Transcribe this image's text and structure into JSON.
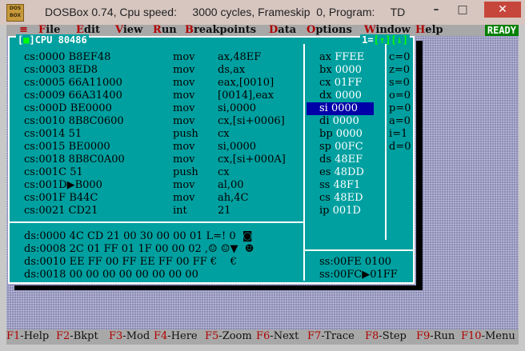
{
  "window": {
    "title": "DOSBox 0.74, Cpu speed:     3000 cycles, Frameskip  0, Program:     TD",
    "icon_text": "DOS BOX",
    "minimize": "–",
    "maximize": "□",
    "close": "✕"
  },
  "menu": {
    "system": "≡",
    "items": [
      {
        "hk": "F",
        "rest": "ile"
      },
      {
        "hk": "E",
        "rest": "dit"
      },
      {
        "hk": "V",
        "rest": "iew"
      },
      {
        "hk": "R",
        "rest": "un"
      },
      {
        "hk": "B",
        "rest": "reakpoints"
      },
      {
        "hk": "D",
        "rest": "ata"
      },
      {
        "hk": "O",
        "rest": "ptions"
      },
      {
        "hk": "W",
        "rest": "indow"
      },
      {
        "hk": "H",
        "rest": "elp"
      }
    ],
    "status": "READY"
  },
  "cpu_window": {
    "title_left_open": "[",
    "title_left_box": "■",
    "title_left_close": "]",
    "title_name": "CPU 80486",
    "title_right_num": "1",
    "title_right_up": "[↑]",
    "title_right_down": "[↓]"
  },
  "disasm": [
    {
      "addr": "cs:0000",
      "bytes": "B8EF48",
      "op": "mov",
      "args": "ax,48EF"
    },
    {
      "addr": "cs:0003",
      "bytes": "8ED8",
      "op": "mov",
      "args": "ds,ax"
    },
    {
      "addr": "cs:0005",
      "bytes": "66A11000",
      "op": "mov",
      "args": "eax,[0010]"
    },
    {
      "addr": "cs:0009",
      "bytes": "66A31400",
      "op": "mov",
      "args": "[0014],eax"
    },
    {
      "addr": "cs:000D",
      "bytes": "BE0000",
      "op": "mov",
      "args": "si,0000"
    },
    {
      "addr": "cs:0010",
      "bytes": "8B8C0600",
      "op": "mov",
      "args": "cx,[si+0006]"
    },
    {
      "addr": "cs:0014",
      "bytes": "51",
      "op": "push",
      "args": "cx"
    },
    {
      "addr": "cs:0015",
      "bytes": "BE0000",
      "op": "mov",
      "args": "si,0000"
    },
    {
      "addr": "cs:0018",
      "bytes": "8B8C0A00",
      "op": "mov",
      "args": "cx,[si+000A]"
    },
    {
      "addr": "cs:001C",
      "bytes": "51",
      "op": "push",
      "args": "cx"
    },
    {
      "addr": "cs:001D▶",
      "bytes": "B000",
      "op": "mov",
      "args": "al,00"
    },
    {
      "addr": "cs:001F",
      "bytes": "B44C",
      "op": "mov",
      "args": "ah,4C"
    },
    {
      "addr": "cs:0021",
      "bytes": "CD21",
      "op": "int",
      "args": "21"
    }
  ],
  "registers": [
    {
      "name": "ax",
      "value": "FFEE"
    },
    {
      "name": "bx",
      "value": "0000"
    },
    {
      "name": "cx",
      "value": "01FF"
    },
    {
      "name": "dx",
      "value": "0000"
    },
    {
      "name": "si",
      "value": "0000"
    },
    {
      "name": "di",
      "value": "0000"
    },
    {
      "name": "bp",
      "value": "0000"
    },
    {
      "name": "sp",
      "value": "00FC"
    },
    {
      "name": "ds",
      "value": "48EF"
    },
    {
      "name": "es",
      "value": "48DD"
    },
    {
      "name": "ss",
      "value": "48F1"
    },
    {
      "name": "cs",
      "value": "48ED"
    },
    {
      "name": "ip",
      "value": "001D"
    }
  ],
  "flags": [
    "c=0",
    "z=0",
    "s=0",
    "o=0",
    "p=0",
    "a=0",
    "i=1",
    "d=0"
  ],
  "dump": [
    "ds:0000 4C CD 21 00 30 00 00 01 L=! 0  ◙",
    "ds:0008 2C 01 FF 01 1F 00 00 02 ,☺ ☺▼  ☻",
    "ds:0010 EE FF 00 FF EE FF 00 FF €    €",
    "ds:0018 00 00 00 00 00 00 00 00"
  ],
  "stack": [
    "ss:00FE 0100",
    "ss:00FC▶01FF"
  ],
  "fnkeys": [
    {
      "k": "F1",
      "t": "-Help"
    },
    {
      "k": "F2",
      "t": "-Bkpt"
    },
    {
      "k": "F3",
      "t": "-Mod"
    },
    {
      "k": "F4",
      "t": "-Here"
    },
    {
      "k": "F5",
      "t": "-Zoom"
    },
    {
      "k": "F6",
      "t": "-Next"
    },
    {
      "k": "F7",
      "t": "-Trace"
    },
    {
      "k": "F8",
      "t": "-Step"
    },
    {
      "k": "F9",
      "t": "-Run"
    },
    {
      "k": "F10",
      "t": "-Menu"
    }
  ]
}
